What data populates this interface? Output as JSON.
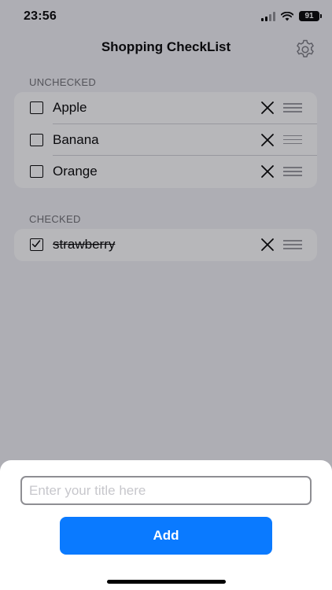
{
  "status_bar": {
    "time": "23:56",
    "battery": "91"
  },
  "nav": {
    "title": "Shopping CheckList"
  },
  "sections": {
    "unchecked": {
      "header": "UNCHECKED",
      "items": [
        {
          "label": "Apple",
          "checked": false
        },
        {
          "label": "Banana",
          "checked": false
        },
        {
          "label": "Orange",
          "checked": false
        }
      ]
    },
    "checked": {
      "header": "CHECKED",
      "items": [
        {
          "label": "strawberry",
          "checked": true
        }
      ]
    }
  },
  "sheet": {
    "input_placeholder": "Enter your title here",
    "input_value": "",
    "add_label": "Add"
  },
  "colors": {
    "accent": "#0a7aff",
    "background": "#f2f2f7"
  },
  "icons": {
    "settings": "gear-icon",
    "delete": "close-icon",
    "reorder": "drag-handle-icon",
    "checkbox_empty": "checkbox-empty-icon",
    "checkbox_checked": "checkbox-checked-icon"
  }
}
